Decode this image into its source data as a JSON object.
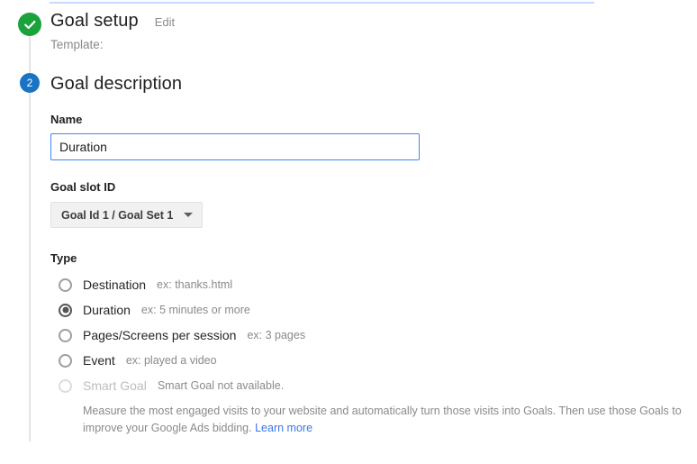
{
  "colors": {
    "top_rule": "#c6dafc",
    "done_badge": "#1ba23c",
    "current_badge": "#1a73c4",
    "focus_border": "#4285f4",
    "link": "#3b78e7"
  },
  "step_done": {
    "badge_icon": "check-icon",
    "title": "Goal setup",
    "edit_label": "Edit",
    "template_label": "Template:"
  },
  "step_current": {
    "badge_number": "2",
    "title": "Goal description"
  },
  "name_field": {
    "label": "Name",
    "value": "Duration",
    "placeholder": ""
  },
  "goal_slot": {
    "label": "Goal slot ID",
    "selected": "Goal Id 1 / Goal Set 1",
    "caret_icon": "chevron-down-icon"
  },
  "type": {
    "label": "Type",
    "options": [
      {
        "name": "Destination",
        "example": "ex: thanks.html",
        "checked": false,
        "disabled": false
      },
      {
        "name": "Duration",
        "example": "ex: 5 minutes or more",
        "checked": true,
        "disabled": false
      },
      {
        "name": "Pages/Screens per session",
        "example": "ex: 3 pages",
        "checked": false,
        "disabled": false
      },
      {
        "name": "Event",
        "example": "ex: played a video",
        "checked": false,
        "disabled": false
      },
      {
        "name": "Smart Goal",
        "example": "Smart Goal not available.",
        "checked": false,
        "disabled": true
      }
    ],
    "smart_goal_description": "Measure the most engaged visits to your website and automatically turn those visits into Goals. Then use those Goals to improve your Google Ads bidding.",
    "smart_goal_link": "Learn more"
  }
}
